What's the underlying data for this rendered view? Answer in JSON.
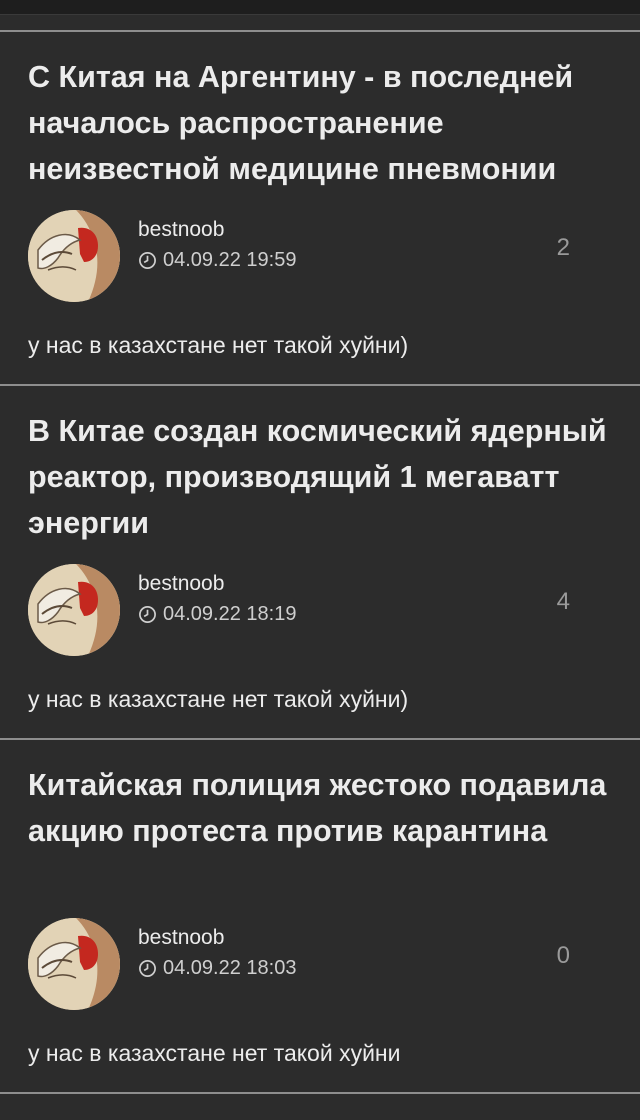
{
  "posts": [
    {
      "title": "С Китая на Аргентину - в последней началось распространение неизвестной медицине пневмонии",
      "author": "bestnoob",
      "datetime": "04.09.22 19:59",
      "count": "2",
      "comment": "у нас в казахстане нет такой хуйни)"
    },
    {
      "title": "В Китае создан космический ядерный реактор, производящий 1 мегаватт энергии",
      "author": "bestnoob",
      "datetime": "04.09.22 18:19",
      "count": "4",
      "comment": "у нас в казахстане нет такой хуйни)"
    },
    {
      "title": "Китайская полиция жестоко подавила акцию протеста против карантина",
      "author": "bestnoob",
      "datetime": "04.09.22 18:03",
      "count": "0",
      "comment": "у нас в казахстане нет такой хуйни"
    }
  ],
  "icons": {
    "avatar": "avatar-image",
    "clock": "clock-icon"
  },
  "colors": {
    "background": "#2c2c2c",
    "divider": "#8e8e8e",
    "text": "#ececec",
    "muted": "#9a9a9a"
  }
}
